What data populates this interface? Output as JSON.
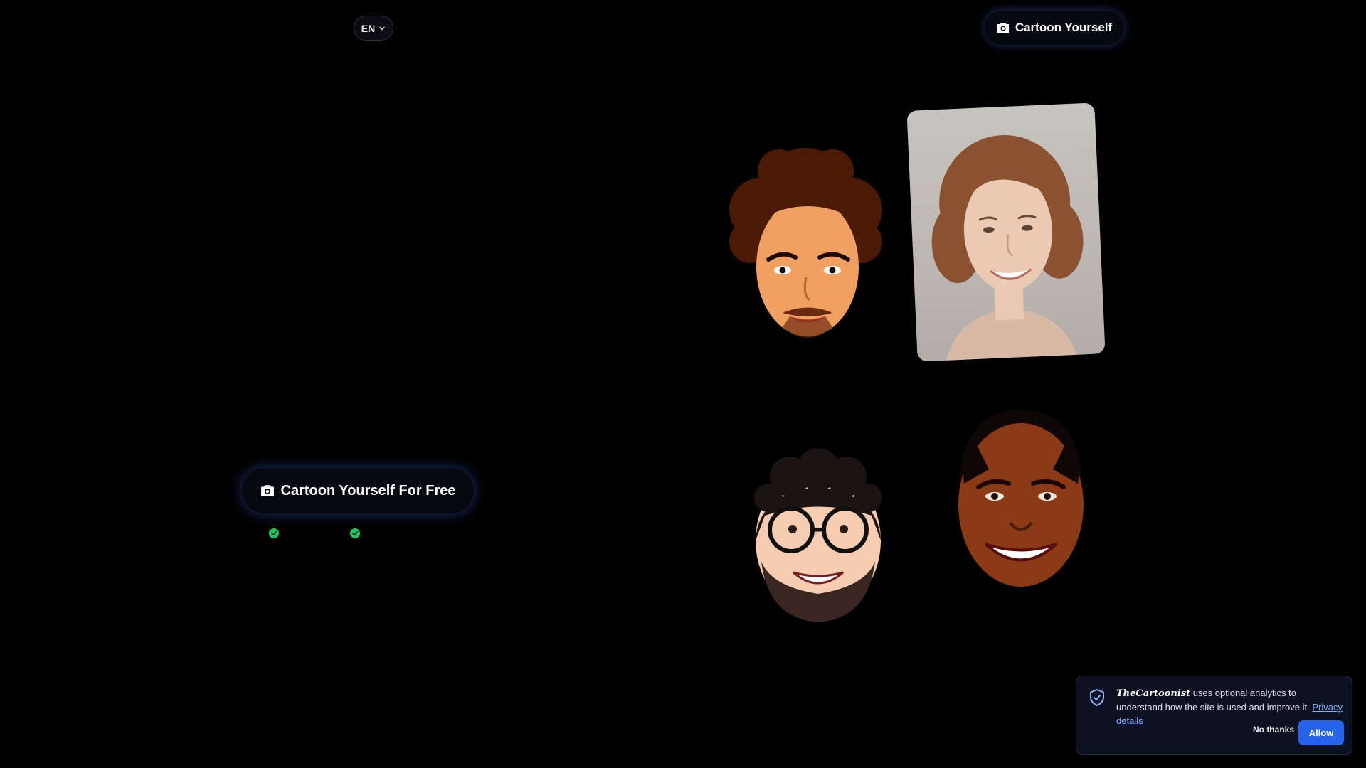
{
  "header": {
    "language": "EN",
    "cta_label": "Cartoon Yourself",
    "cta_icon": "camera-icon"
  },
  "hero": {
    "cta_label": "Cartoon Yourself For Free",
    "cta_icon": "camera-icon",
    "feature_icons": [
      "check-circle-icon",
      "check-circle-icon"
    ]
  },
  "gallery": {
    "items": [
      "cartoon-curly-hair-man",
      "photo-woman",
      "cartoon-glasses-man",
      "cartoon-smiling-man"
    ]
  },
  "cookie_banner": {
    "brand": "TheCartoonist",
    "message": " uses optional analytics to understand how the site is used and improve it. ",
    "privacy_link": "Privacy details",
    "decline_label": "No thanks",
    "accept_label": "Allow"
  },
  "colors": {
    "background": "#000000",
    "accent_blue": "#2563eb",
    "check_green": "#22c55e",
    "banner_bg": "#0b1120"
  }
}
